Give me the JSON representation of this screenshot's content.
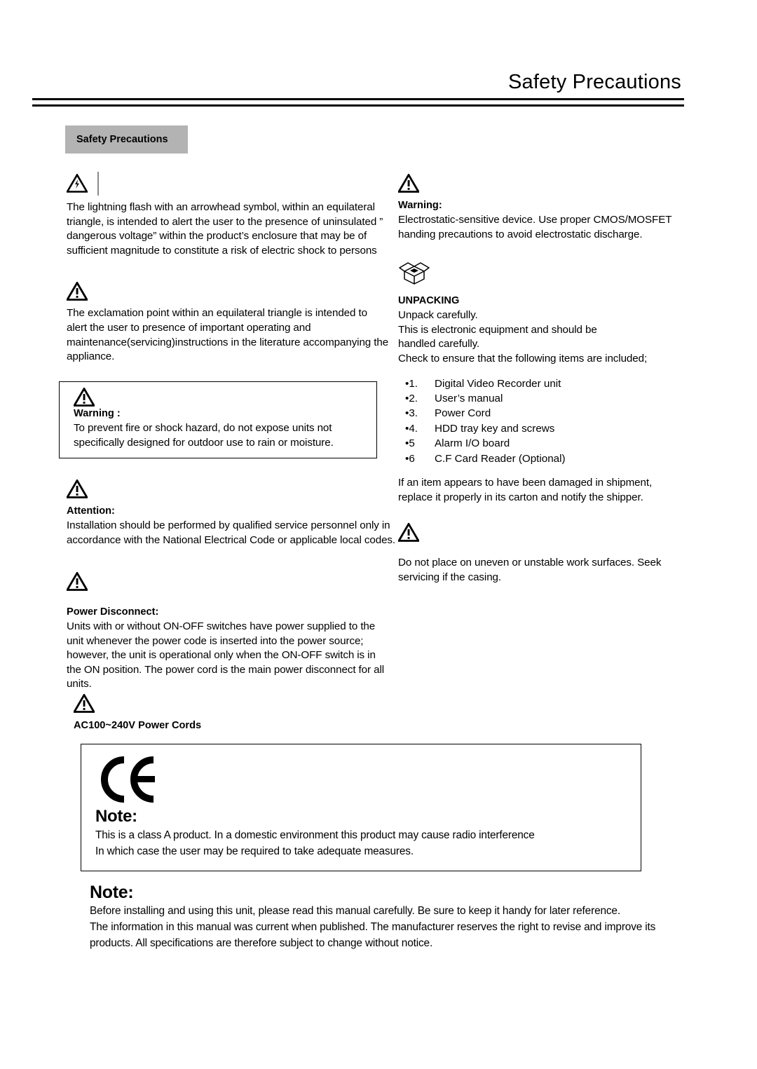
{
  "header": {
    "title": "Safety Precautions"
  },
  "section_tab": {
    "label": "Safety Precautions"
  },
  "left_column": {
    "lightning_block": {
      "icon": "lightning-bolt-triangle-icon",
      "text": "The lightning flash with an arrowhead symbol, within an equilateral triangle, is intended to alert the user to the presence of uninsulated ” dangerous voltage” within the product’s enclosure that may be of sufficient magnitude to constitute a risk of electric shock to persons"
    },
    "exclamation_block": {
      "icon": "warning-triangle-icon",
      "text": "The exclamation point within an equilateral triangle is intended to alert the user to presence of important operating and maintenance(servicing)instructions in the literature accompanying the appliance."
    },
    "warning_box": {
      "icon": "warning-triangle-icon",
      "heading": "Warning :",
      "text": "To prevent fire or shock hazard, do not expose units not specifically designed for outdoor use to rain or moisture."
    },
    "attention_block": {
      "icon": "warning-triangle-icon",
      "heading": "Attention:",
      "text": "Installation should be performed by qualified service personnel only in accordance with the National Electrical Code or applicable local codes."
    },
    "power_disconnect_block": {
      "icon": "warning-triangle-icon",
      "heading": "Power Disconnect:",
      "text": "Units with or without ON-OFF switches have power supplied to the unit whenever the power code is inserted into the power source; however, the unit is operational only when the ON-OFF switch is in the ON position. The power cord is the main power disconnect for all units."
    },
    "power_cords_block": {
      "icon": "warning-triangle-icon",
      "heading": "AC100~240V Power Cords"
    }
  },
  "right_column": {
    "esd_warning_block": {
      "icon": "warning-triangle-icon",
      "heading": "Warning:",
      "text": "Electrostatic-sensitive device. Use proper CMOS/MOSFET handing precautions to avoid electrostatic discharge."
    },
    "unpacking_block": {
      "icon": "open-box-icon",
      "heading": "UNPACKING",
      "lines": [
        "Unpack carefully.",
        "This is electronic equipment and should be",
        "handled carefully.",
        "Check to ensure that the following items are included;"
      ],
      "items": [
        {
          "num": "•1.",
          "label": "Digital Video Recorder unit"
        },
        {
          "num": "•2.",
          "label": "User’s manual"
        },
        {
          "num": "•3.",
          "label": "Power Cord"
        },
        {
          "num": "•4.",
          "label": " HDD tray key and screws"
        },
        {
          "num": "•5",
          "label": "Alarm I/O board"
        },
        {
          "num": "•6",
          "label": "C.F Card Reader (Optional)"
        }
      ],
      "shipment_note": "If an item appears to have been damaged in shipment, replace it properly in its carton and notify the shipper."
    },
    "surface_warning_block": {
      "icon": "warning-triangle-icon",
      "text": "Do not place on uneven or unstable work surfaces. Seek servicing if the casing."
    }
  },
  "ce_note_box": {
    "icon": "ce-mark-icon",
    "heading": "Note:",
    "line1": "This is a class A product. In a domestic environment this product may cause radio interference",
    "line2": "In which case the user may be required to take adequate measures."
  },
  "final_note": {
    "heading": "Note:",
    "line1": "Before installing and using this unit, please read this manual carefully. Be sure to keep it handy for later reference.",
    "line2": "The information in this manual was current when published.  The manufacturer reserves the right to revise and improve its products.  All specifications are therefore subject to change without notice."
  },
  "colors": {
    "tab_background": "#b3b3b3",
    "text": "#000000",
    "rule": "#000000"
  }
}
